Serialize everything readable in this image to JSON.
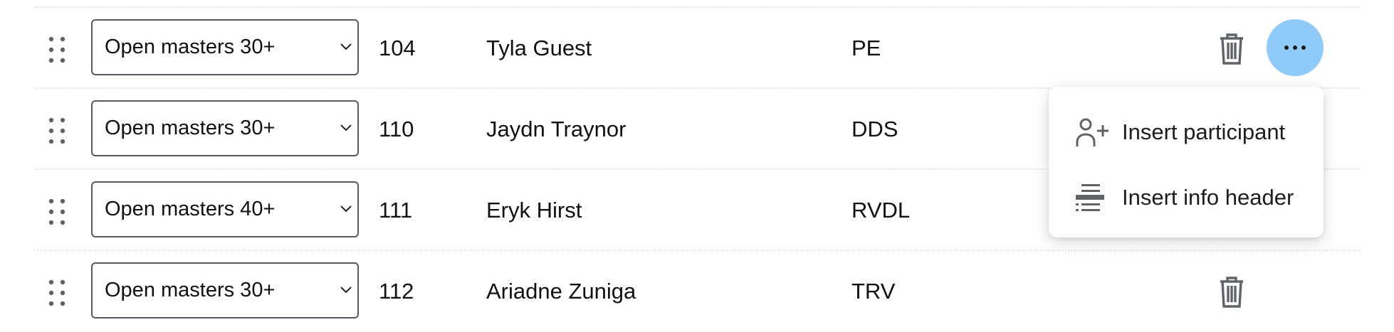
{
  "rows": [
    {
      "category": "Open masters 30+",
      "number": "104",
      "name": "Tyla Guest",
      "club": "PE"
    },
    {
      "category": "Open masters 30+",
      "number": "110",
      "name": "Jaydn Traynor",
      "club": "DDS"
    },
    {
      "category": "Open masters 40+",
      "number": "111",
      "name": "Eryk Hirst",
      "club": "RVDL"
    },
    {
      "category": "Open masters 30+",
      "number": "112",
      "name": "Ariadne Zuniga",
      "club": "TRV"
    }
  ],
  "menu": {
    "items": [
      {
        "label": "Insert participant",
        "icon": "person-add-icon"
      },
      {
        "label": "Insert info header",
        "icon": "list-header-icon"
      }
    ]
  },
  "colors": {
    "more_button_bg": "#90caf9",
    "icon_gray": "#5f6368",
    "row_divider": "#e3e3e3"
  },
  "icons": {
    "drag": "drag-handle-icon",
    "delete": "trash-icon",
    "more": "more-horizontal-icon",
    "select": "chevron-down-icon"
  }
}
